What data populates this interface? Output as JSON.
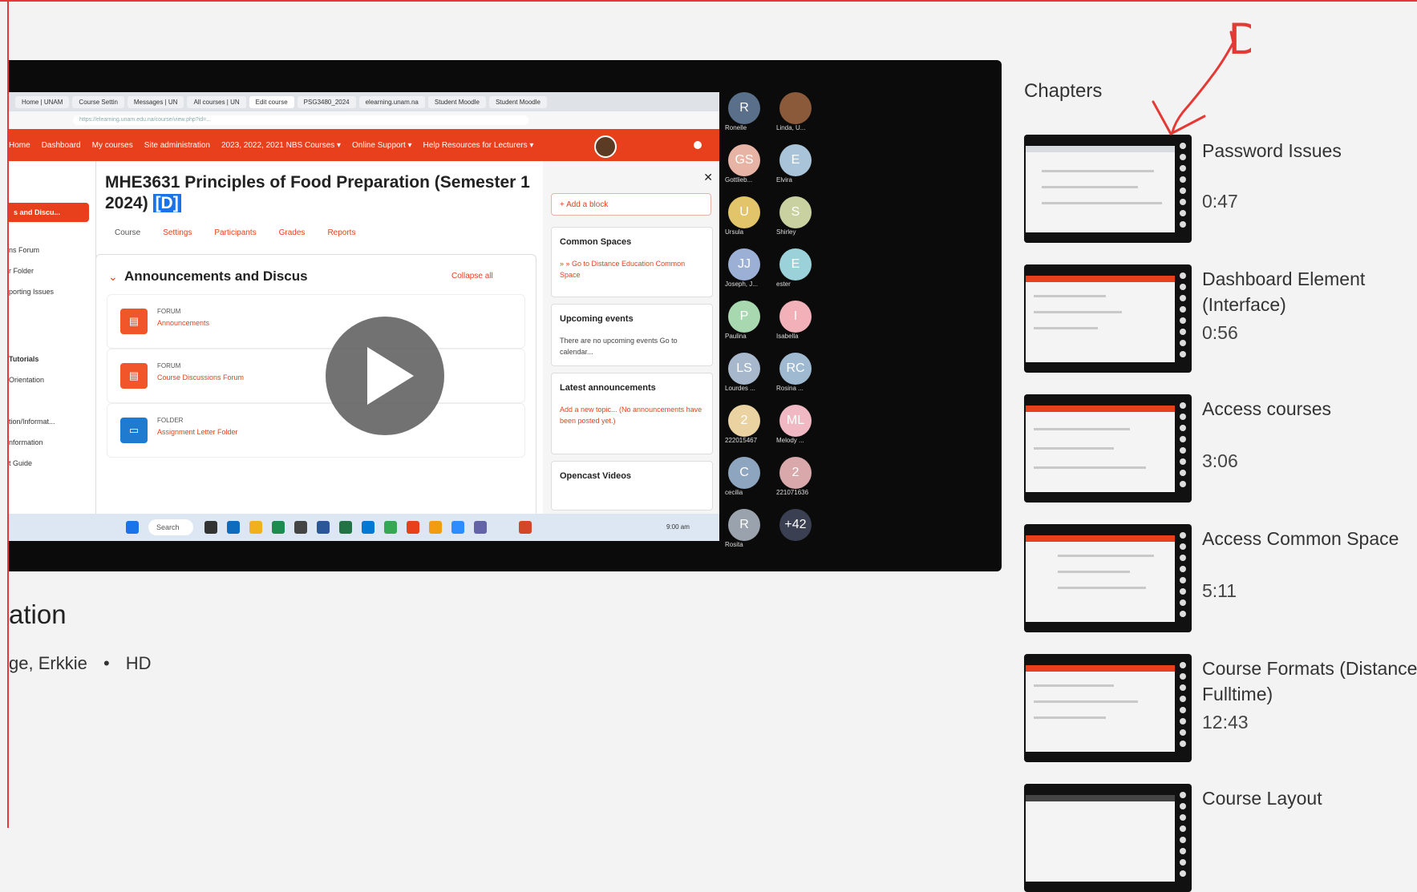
{
  "browser": {
    "tabs": [
      "Home | UNAM",
      "Course Settin",
      "Messages | UN",
      "All courses | UN",
      "Edit course",
      "PSG3480_2024",
      "elearning.unam.na",
      "Student Moodle",
      "Student Moodle"
    ],
    "url": "https://elearning.unam.edu.na/course/view.php?id=..."
  },
  "moodle": {
    "nav": [
      "Home",
      "Dashboard",
      "My courses",
      "Site administration",
      "2023, 2022, 2021 NBS Courses ▾",
      "Online Support ▾",
      "Help Resources for Lecturers ▾"
    ],
    "left_menu_active": "s and Discu...",
    "left_menu": [
      "ns Forum",
      "r Folder",
      "porting Issues",
      "Tutorials",
      "Orientation",
      "tion/Informat...",
      "nformation",
      "t Guide"
    ],
    "course_title": "MHE3631 Principles of Food Preparation (Semester 1 2024)",
    "course_tag": "[D]",
    "course_tabs": [
      "Course",
      "Settings",
      "Participants",
      "Grades",
      "Reports"
    ],
    "section_title": "Announcements and Discus",
    "collapse_all": "Collapse all",
    "activities": [
      {
        "type": "FORUM",
        "name": "Announcements",
        "icon": "forum-icon"
      },
      {
        "type": "FORUM",
        "name": "Course Discussions Forum",
        "icon": "forum-icon"
      },
      {
        "type": "FOLDER",
        "name": "Assignment Letter Folder",
        "icon": "folder-icon"
      }
    ],
    "add_block": "+ Add a block",
    "blocks": [
      {
        "title": "Common Spaces",
        "text": "» » Go to Distance Education Common Space",
        "dark": false
      },
      {
        "title": "Upcoming events",
        "text": "There are no upcoming events  Go to calendar...",
        "dark": true
      },
      {
        "title": "Latest announcements",
        "text": "Add a new topic...  (No announcements have been posted yet.)",
        "dark": false
      },
      {
        "title": "Opencast Videos",
        "text": "",
        "dark": false
      }
    ],
    "taskbar_search": "Search",
    "taskbar_clock": "9:00 am"
  },
  "participants": [
    {
      "initials": "R",
      "name": "Ronelle",
      "color": "#5a6f8a"
    },
    {
      "initials": "",
      "name": "Linda, U...",
      "color": "#8a5a3a"
    },
    {
      "initials": "GS",
      "name": "Gottlieb...",
      "color": "#e7b3a4"
    },
    {
      "initials": "E",
      "name": "Elvira",
      "color": "#a9c4d8"
    },
    {
      "initials": "U",
      "name": "Ursula",
      "color": "#e2c46a"
    },
    {
      "initials": "S",
      "name": "Shirley",
      "color": "#c9d1a0"
    },
    {
      "initials": "JJ",
      "name": "Joseph, J...",
      "color": "#9cb0d6"
    },
    {
      "initials": "E",
      "name": "ester",
      "color": "#9bd1d9"
    },
    {
      "initials": "P",
      "name": "Paulina",
      "color": "#a8d8b0"
    },
    {
      "initials": "I",
      "name": "Isabella",
      "color": "#f2b1b8"
    },
    {
      "initials": "LS",
      "name": "Lourdes ...",
      "color": "#a7b8cc"
    },
    {
      "initials": "RC",
      "name": "Rosina ...",
      "color": "#9fbad0"
    },
    {
      "initials": "2",
      "name": "222015467",
      "color": "#ead3a0"
    },
    {
      "initials": "ML",
      "name": "Melody ...",
      "color": "#f0b8c2"
    },
    {
      "initials": "C",
      "name": "cecilia",
      "color": "#8ea5bf"
    },
    {
      "initials": "2",
      "name": "221071636",
      "color": "#d8a8aa"
    },
    {
      "initials": "R",
      "name": "Rosita",
      "color": "#9aa3ad"
    },
    {
      "initials": "+42",
      "name": "",
      "color": "#3a3f52"
    }
  ],
  "video": {
    "title": "ation",
    "authors": "ge, Erkkie",
    "separator": "•",
    "quality": "HD"
  },
  "chapters_heading": "Chapters",
  "chapters": [
    {
      "title": "Password Issues",
      "time": "0:47"
    },
    {
      "title": "Dashboard Element (Interface)",
      "time": "0:56"
    },
    {
      "title": "Access courses",
      "time": "3:06"
    },
    {
      "title": "Access Common Space",
      "time": "5:11"
    },
    {
      "title": "Course Formats (Distance Fulltime)",
      "time": "12:43"
    },
    {
      "title": "Course Layout",
      "time": ""
    }
  ],
  "annotation": {
    "letter": "D",
    "color": "#e53935"
  },
  "colors": {
    "moodle_accent": "#e8401c",
    "page_bg": "#f3f3f3",
    "player_bg": "#0b0b0b"
  }
}
